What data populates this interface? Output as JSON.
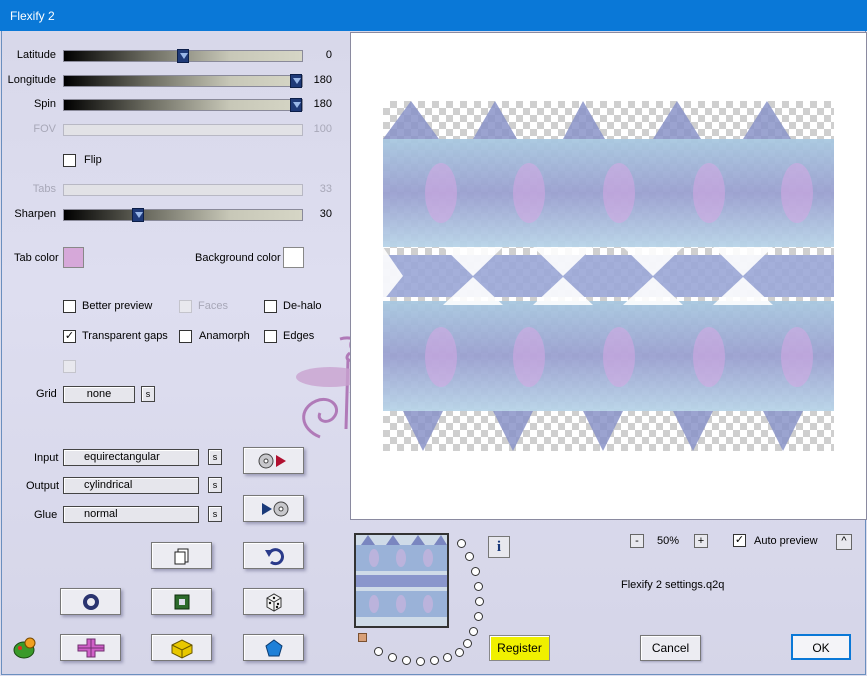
{
  "window": {
    "title": "Flexify 2"
  },
  "sliders": [
    {
      "key": "latitude",
      "label": "Latitude",
      "value": "0",
      "fraction": 0.5,
      "enabled": true
    },
    {
      "key": "longitude",
      "label": "Longitude",
      "value": "180",
      "fraction": 1.0,
      "enabled": true
    },
    {
      "key": "spin",
      "label": "Spin",
      "value": "180",
      "fraction": 1.0,
      "enabled": true
    },
    {
      "key": "fov",
      "label": "FOV",
      "value": "100",
      "fraction": 0.0,
      "enabled": false
    },
    {
      "key": "tabs",
      "label": "Tabs",
      "value": "33",
      "fraction": 0.0,
      "enabled": false
    },
    {
      "key": "sharpen",
      "label": "Sharpen",
      "value": "30",
      "fraction": 0.3,
      "enabled": true
    }
  ],
  "flip": {
    "label": "Flip",
    "checked": false
  },
  "colors": {
    "tab_color_label": "Tab color",
    "tab_color": "#d6a8d9",
    "background_color_label": "Background color",
    "background_color": "#ffffff",
    "accent_blue": "#0a78d7",
    "register_yellow": "#f0f000"
  },
  "options": {
    "better_preview": {
      "label": "Better preview",
      "checked": false,
      "enabled": true
    },
    "faces": {
      "label": "Faces",
      "checked": false,
      "enabled": false
    },
    "de_halo": {
      "label": "De-halo",
      "checked": false,
      "enabled": true
    },
    "transparent_gaps": {
      "label": "Transparent gaps",
      "checked": true,
      "enabled": true
    },
    "anamorph": {
      "label": "Anamorph",
      "checked": false,
      "enabled": true
    },
    "edges": {
      "label": "Edges",
      "checked": false,
      "enabled": true
    },
    "extra": {
      "checked": false,
      "enabled": false
    }
  },
  "grid": {
    "label": "Grid",
    "value": "none",
    "s": "s"
  },
  "projection": {
    "input_label": "Input",
    "input_value": "equirectangular",
    "output_label": "Output",
    "output_value": "cylindrical",
    "glue_label": "Glue",
    "glue_value": "normal",
    "s": "s"
  },
  "zoom": {
    "minus": "-",
    "value": "50%",
    "plus": "+"
  },
  "auto_preview": {
    "label": "Auto preview",
    "checked": true,
    "caret": "^"
  },
  "settings_file": "Flexify 2 settings.q2q",
  "info_button": "i",
  "buttons": {
    "register": "Register",
    "cancel": "Cancel",
    "ok": "OK"
  },
  "icons": {
    "load": "play-load-icon",
    "save": "save-play-icon",
    "copy": "copy-icon",
    "undo": "undo-icon",
    "ring": "ring-icon",
    "square": "square-frame-icon",
    "dice": "dice-icon",
    "cross": "cross-icon",
    "cube": "cube-icon",
    "gem": "pentagon-gem-icon",
    "app": "frog-app-icon"
  }
}
